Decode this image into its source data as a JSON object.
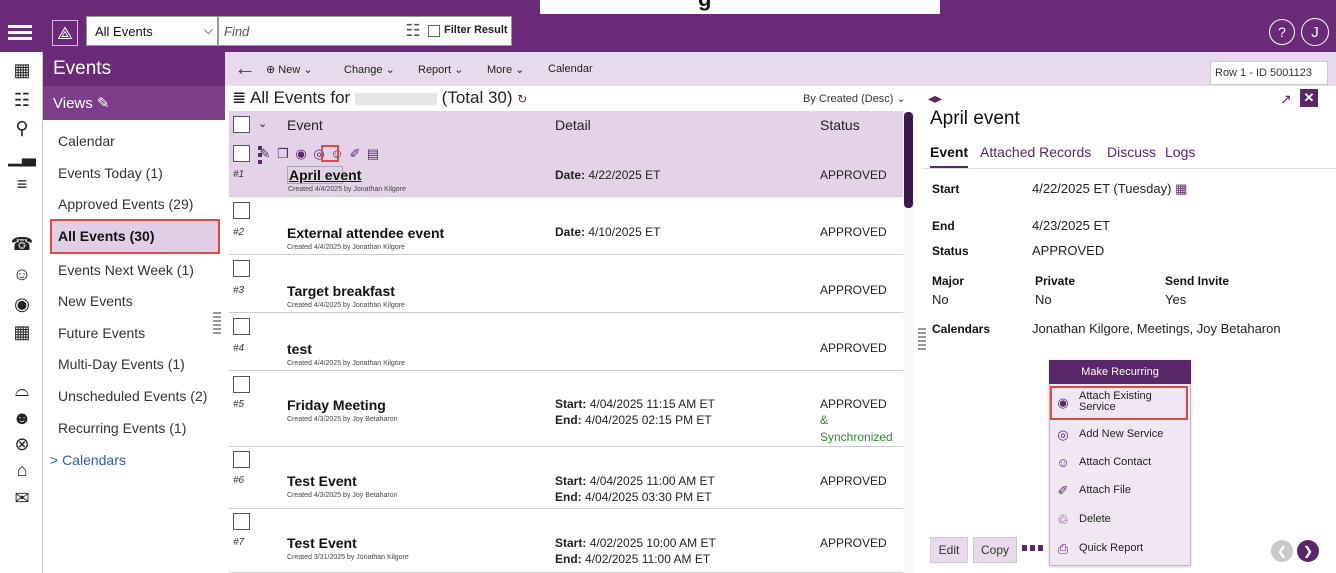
{
  "header": {
    "top_text": "g",
    "view_select": "All Events",
    "find_placeholder": "Find",
    "filter_label": "Filter Result",
    "help": "?",
    "user": "J"
  },
  "sidebar": {
    "title": "Events",
    "views_label": "Views",
    "items": [
      "Calendar",
      "Events Today (1)",
      "Approved Events (29)",
      "All Events (30)",
      "Events Next Week (1)",
      "New Events",
      "Future Events",
      "Multi-Day Events (1)",
      "Unscheduled Events (2)",
      "Recurring Events (1)"
    ],
    "calendars": "> Calendars"
  },
  "toolbar": {
    "new": "New",
    "change": "Change",
    "report": "Report",
    "more": "More",
    "calendar": "Calendar",
    "row_id": "Row 1 - ID 5001123"
  },
  "list": {
    "title": "All Events for",
    "total": "(Total 30)",
    "sort": "By Created (Desc)",
    "col_event": "Event",
    "col_detail": "Detail",
    "col_status": "Status",
    "rows": [
      {
        "num": "#1",
        "name": "April event",
        "created": "Created 4/4/2025 by Jonathan Kilgore",
        "d1l": "Date:",
        "d1": "4/22/2025 ET",
        "d2l": "",
        "d2": "",
        "status": "APPROVED",
        "sync": ""
      },
      {
        "num": "#2",
        "name": "External attendee event",
        "created": "Created 4/4/2025 by Jonathan Kilgore",
        "d1l": "Date:",
        "d1": "4/10/2025 ET",
        "d2l": "",
        "d2": "",
        "status": "APPROVED",
        "sync": ""
      },
      {
        "num": "#3",
        "name": "Target breakfast",
        "created": "Created 4/4/2025 by Jonathan Kilgore",
        "d1l": "",
        "d1": "",
        "d2l": "",
        "d2": "",
        "status": "APPROVED",
        "sync": ""
      },
      {
        "num": "#4",
        "name": "test",
        "created": "Created 4/4/2025 by Jonathan Kilgore",
        "d1l": "",
        "d1": "",
        "d2l": "",
        "d2": "",
        "status": "APPROVED",
        "sync": ""
      },
      {
        "num": "#5",
        "name": "Friday Meeting",
        "created": "Created 4/3/2025 by Joy Betaharon",
        "d1l": "Start:",
        "d1": "4/04/2025 11:15 AM ET",
        "d2l": "End:",
        "d2": "4/04/2025 02:15 PM ET",
        "status": "APPROVED",
        "sync": "&",
        "sync2": "Synchronized"
      },
      {
        "num": "#6",
        "name": "Test Event",
        "created": "Created 4/3/2025 by Joy Betaharon",
        "d1l": "Start:",
        "d1": "4/04/2025 11:00 AM ET",
        "d2l": "End:",
        "d2": "4/04/2025 03:30 PM ET",
        "status": "APPROVED",
        "sync": ""
      },
      {
        "num": "#7",
        "name": "Test Event",
        "created": "Created 3/31/2025 by Jonathan Kilgore",
        "d1l": "Start:",
        "d1": "4/02/2025 10:00 AM ET",
        "d2l": "End:",
        "d2": "4/02/2025 11:00 AM ET",
        "status": "APPROVED",
        "sync": ""
      }
    ]
  },
  "detail": {
    "title": "April event",
    "tabs": [
      "Event",
      "Attached Records",
      "Discuss",
      "Logs"
    ],
    "start_label": "Start",
    "start_value": "4/22/2025 ET (Tuesday)",
    "end_label": "End",
    "end_value": "4/23/2025 ET",
    "status_label": "Status",
    "status_value": "APPROVED",
    "major_label": "Major",
    "major_value": "No",
    "private_label": "Private",
    "private_value": "No",
    "invite_label": "Send Invite",
    "invite_value": "Yes",
    "calendars_label": "Calendars",
    "calendars_value": "Jonathan Kilgore, Meetings, Joy Betaharon",
    "edit": "Edit",
    "copy": "Copy"
  },
  "menu": {
    "header": "Make Recurring",
    "items": [
      "Attach Existing Service",
      "Add New Service",
      "Attach Contact",
      "Attach File",
      "Delete",
      "Quick Report"
    ]
  },
  "colors": {
    "brand": "#6b2a78",
    "highlight": "#d94a4a",
    "sync": "#2f8b2f"
  }
}
